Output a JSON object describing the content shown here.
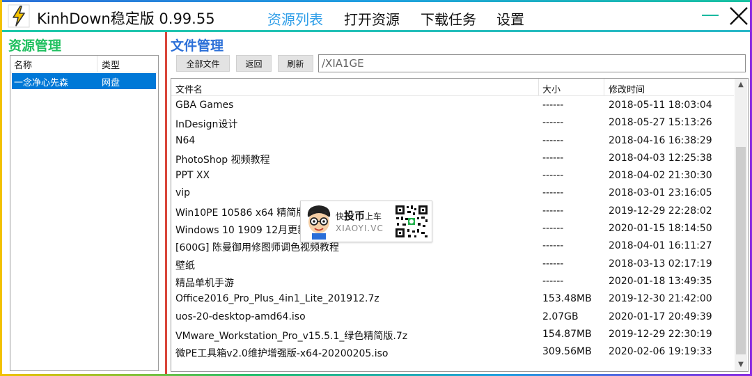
{
  "app": {
    "title": "KinhDown稳定版 0.99.55"
  },
  "nav": [
    {
      "label": "资源列表",
      "active": true
    },
    {
      "label": "打开资源",
      "active": false
    },
    {
      "label": "下载任务",
      "active": false
    },
    {
      "label": "设置",
      "active": false
    }
  ],
  "colors": {
    "accent_blue": "#2f9ee8",
    "left_heading": "#20c060",
    "right_heading": "#2b6fd8",
    "selection": "#0078d7",
    "separator": "#d9463a"
  },
  "resource_panel": {
    "heading": "资源管理",
    "columns": [
      "名称",
      "类型"
    ],
    "rows": [
      {
        "name": "一念净心先森",
        "type": "网盘",
        "selected": true
      }
    ]
  },
  "file_panel": {
    "heading": "文件管理",
    "buttons": {
      "all_files": "全部文件",
      "back": "返回",
      "refresh": "刷新"
    },
    "path": "/XIA1GE",
    "columns": {
      "name": "文件名",
      "size": "大小",
      "modified": "修改时间"
    },
    "files": [
      {
        "name": "GBA Games",
        "size": "------",
        "modified": "2018-05-11 18:03:04"
      },
      {
        "name": "InDesign设计",
        "size": "------",
        "modified": "2018-05-27 15:13:26"
      },
      {
        "name": "N64",
        "size": "------",
        "modified": "2018-04-16 16:38:29"
      },
      {
        "name": "PhotoShop 视频教程",
        "size": "------",
        "modified": "2018-04-03 12:25:38"
      },
      {
        "name": "PPT XX",
        "size": "------",
        "modified": "2018-04-02 21:30:30"
      },
      {
        "name": "vip",
        "size": "------",
        "modified": "2018-03-01 23:16:05"
      },
      {
        "name": "Win10PE 10586 x64 精简版",
        "size": "------",
        "modified": "2019-12-29 22:28:02"
      },
      {
        "name": "Windows 10 1909 12月更新",
        "size": "------",
        "modified": "2020-01-15 18:14:50"
      },
      {
        "name": "[600G] 陈曼御用修图师调色视频教程",
        "size": "------",
        "modified": "2018-04-01 16:11:27"
      },
      {
        "name": "壁纸",
        "size": "------",
        "modified": "2018-03-13 02:17:19"
      },
      {
        "name": "精品单机手游",
        "size": "------",
        "modified": "2020-01-18 13:49:35"
      },
      {
        "name": "Office2016_Pro_Plus_4in1_Lite_201912.7z",
        "size": "153.48MB",
        "modified": "2019-12-30 21:42:00"
      },
      {
        "name": "uos-20-desktop-amd64.iso",
        "size": "2.07GB",
        "modified": "2020-01-17 20:49:39"
      },
      {
        "name": "VMware_Workstation_Pro_v15.5.1_绿色精简版.7z",
        "size": "154.87MB",
        "modified": "2019-12-29 22:30:19"
      },
      {
        "name": "微PE工具箱v2.0维护增强版-x64-20200205.iso",
        "size": "309.56MB",
        "modified": "2020-02-06 19:19:33"
      }
    ],
    "scroll_fraction_visible": 0.72
  },
  "watermark": {
    "line1_prefix": "快",
    "line1_bold": "投币",
    "line1_suffix": "上车",
    "line2": "XIAOYI.VC"
  }
}
